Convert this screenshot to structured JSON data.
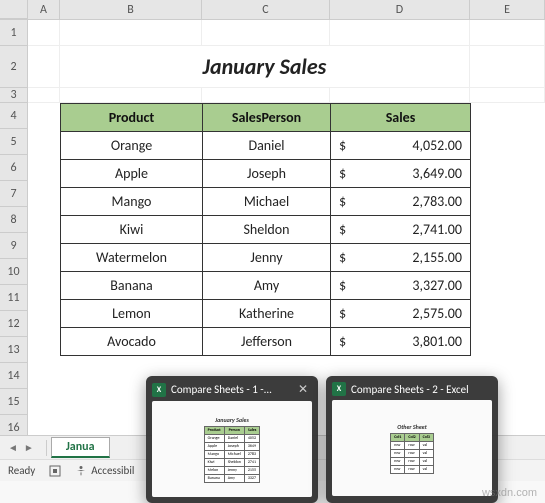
{
  "columns": [
    "A",
    "B",
    "C",
    "D",
    "E"
  ],
  "row_numbers": [
    1,
    2,
    3,
    4,
    5,
    6,
    7,
    8,
    9,
    10,
    11,
    12,
    13,
    14,
    15,
    16
  ],
  "title": "January Sales",
  "headers": {
    "product": "Product",
    "person": "SalesPerson",
    "sales": "Sales"
  },
  "rows": [
    {
      "product": "Orange",
      "person": "Daniel",
      "currency": "$",
      "sales": "4,052.00"
    },
    {
      "product": "Apple",
      "person": "Joseph",
      "currency": "$",
      "sales": "3,649.00"
    },
    {
      "product": "Mango",
      "person": "Michael",
      "currency": "$",
      "sales": "2,783.00"
    },
    {
      "product": "Kiwi",
      "person": "Sheldon",
      "currency": "$",
      "sales": "2,741.00"
    },
    {
      "product": "Watermelon",
      "person": "Jenny",
      "currency": "$",
      "sales": "2,155.00"
    },
    {
      "product": "Banana",
      "person": "Amy",
      "currency": "$",
      "sales": "3,327.00"
    },
    {
      "product": "Lemon",
      "person": "Katherine",
      "currency": "$",
      "sales": "2,575.00"
    },
    {
      "product": "Avocado",
      "person": "Jefferson",
      "currency": "$",
      "sales": "3,801.00"
    }
  ],
  "sheet_tab": "Janua",
  "status": {
    "ready": "Ready",
    "accessibility": "Accessibil"
  },
  "taskbar": {
    "thumbs": [
      {
        "title": "Compare Sheets  -  1 -...",
        "preview_title": "January Sales"
      },
      {
        "title": "Compare Sheets  -  2 - Excel",
        "preview_title": "Other Sheet"
      }
    ]
  },
  "watermark": "wsxdn.com",
  "chart_data": {
    "type": "table",
    "title": "January Sales",
    "columns": [
      "Product",
      "SalesPerson",
      "Sales"
    ],
    "data": [
      [
        "Orange",
        "Daniel",
        4052.0
      ],
      [
        "Apple",
        "Joseph",
        3649.0
      ],
      [
        "Mango",
        "Michael",
        2783.0
      ],
      [
        "Kiwi",
        "Sheldon",
        2741.0
      ],
      [
        "Watermelon",
        "Jenny",
        2155.0
      ],
      [
        "Banana",
        "Amy",
        3327.0
      ],
      [
        "Lemon",
        "Katherine",
        2575.0
      ],
      [
        "Avocado",
        "Jefferson",
        3801.0
      ]
    ]
  }
}
